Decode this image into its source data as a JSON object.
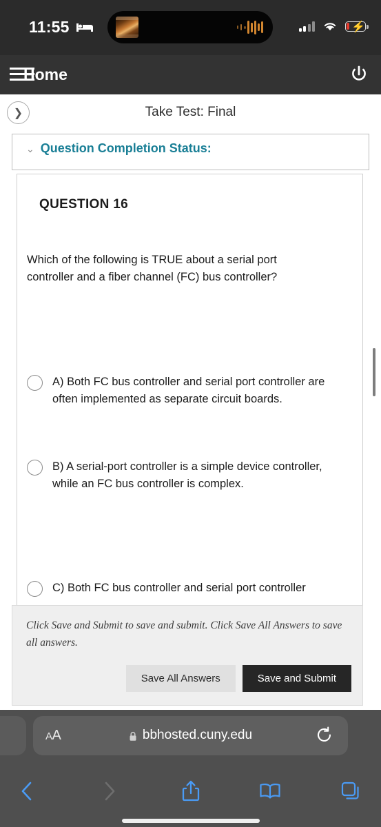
{
  "status_bar": {
    "time": "11:55",
    "bed_icon": "bed-icon",
    "focus_icon_name": "sleep-focus-bed-icon",
    "cellular_icon": "cellular-signal-icon",
    "wifi_icon": "wifi-icon",
    "battery_icon": "battery-charging-low-icon",
    "battery_color": "#e83b2e",
    "dynamic_island": {
      "media_thumbnail": "now-playing-thumbnail",
      "waveform_icon": "audio-waveform-icon",
      "waveform_color": "#d2862f"
    }
  },
  "app_header": {
    "menu_icon": "hamburger-menu-icon",
    "home_label": "Home",
    "power_icon": "power-logout-icon",
    "background": "#333333"
  },
  "title_bar": {
    "back_icon": "chevron-right-circle-icon",
    "title": "Take Test: Final"
  },
  "content": {
    "completion_status": {
      "chevron_icon": "double-chevron-down-icon",
      "label": "Question Completion Status:",
      "accent_color": "#1a7f96"
    },
    "question": {
      "number_label": "QUESTION 16",
      "prompt": "Which of the following is TRUE about a serial port controller and a fiber channel (FC) bus controller?",
      "options": [
        {
          "id": "A",
          "text": "A) Both FC bus controller and serial port controller are often implemented as separate circuit boards.",
          "selected": false
        },
        {
          "id": "B",
          "text": "B) A serial-port controller is a simple device controller, while an FC bus controller is complex.",
          "selected": false
        },
        {
          "id": "C",
          "text": "C) Both FC bus controller and serial port controller",
          "selected": false
        }
      ]
    },
    "scrollbar": "vertical-scrollbar"
  },
  "footer": {
    "note": "Click Save and Submit to save and submit. Click Save All Answers to save all answers.",
    "save_all_label": "Save All Answers",
    "save_submit_label": "Save and Submit",
    "save_submit_color": "#262626"
  },
  "safari": {
    "font_size_label_small": "A",
    "font_size_label_large": "A",
    "lock_icon": "lock-icon",
    "url": "bbhosted.cuny.edu",
    "reload_icon": "reload-icon",
    "tools": {
      "back_icon": "back-chevron-icon",
      "forward_icon": "forward-chevron-icon",
      "share_icon": "share-icon",
      "bookmarks_icon": "bookmarks-book-icon",
      "tabs_icon": "tabs-icon"
    },
    "accent_color": "#4a9bf5",
    "home_indicator": "home-indicator"
  }
}
